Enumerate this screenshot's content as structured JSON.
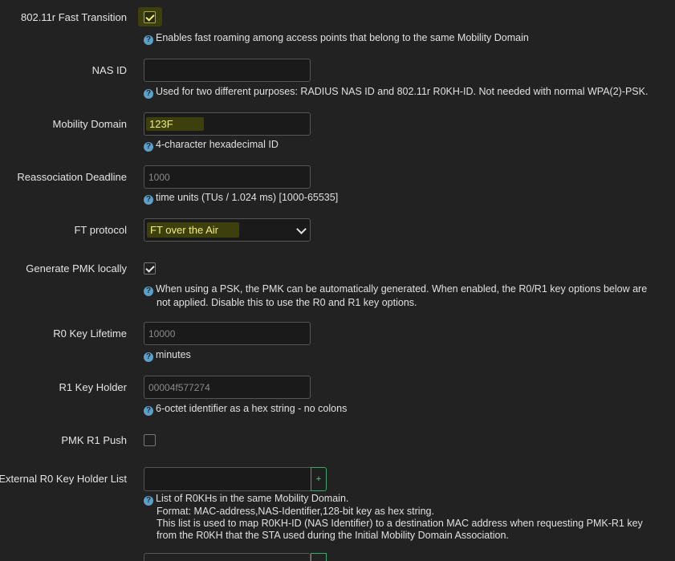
{
  "fast_transition": {
    "label": "802.11r Fast Transition",
    "checked": true,
    "help": "Enables fast roaming among access points that belong to the same Mobility Domain"
  },
  "nas_id": {
    "label": "NAS ID",
    "value": "",
    "help": "Used for two different purposes: RADIUS NAS ID and 802.11r R0KH-ID. Not needed with normal WPA(2)-PSK."
  },
  "mobility_domain": {
    "label": "Mobility Domain",
    "value": "123F",
    "help": "4-character hexadecimal ID"
  },
  "reassociation_deadline": {
    "label": "Reassociation Deadline",
    "placeholder": "1000",
    "help": "time units (TUs / 1.024 ms) [1000-65535]"
  },
  "ft_protocol": {
    "label": "FT protocol",
    "selected": "FT over the Air"
  },
  "generate_pmk": {
    "label": "Generate PMK locally",
    "checked": true,
    "help_line1": "When using a PSK, the PMK can be automatically generated. When enabled, the R0/R1 key options below are",
    "help_line2": "not applied. Disable this to use the R0 and R1 key options."
  },
  "r0_key_lifetime": {
    "label": "R0 Key Lifetime",
    "placeholder": "10000",
    "help": "minutes"
  },
  "r1_key_holder": {
    "label": "R1 Key Holder",
    "placeholder": "00004f577274",
    "help": "6-octet identifier as a hex string - no colons"
  },
  "pmk_r1_push": {
    "label": "PMK R1 Push",
    "checked": false
  },
  "external_r0_list": {
    "label": "External R0 Key Holder List",
    "value": "",
    "add_label": "+",
    "help_line1": "List of R0KHs in the same Mobility Domain.",
    "help_line2": "Format: MAC-address,NAS-Identifier,128-bit key as hex string.",
    "help_line3": "This list is used to map R0KH-ID (NAS Identifier) to a destination MAC address when requesting PMK-R1 key",
    "help_line4": "from the R0KH that the STA used during the Initial Mobility Domain Association."
  },
  "help_icon_glyph": "?"
}
